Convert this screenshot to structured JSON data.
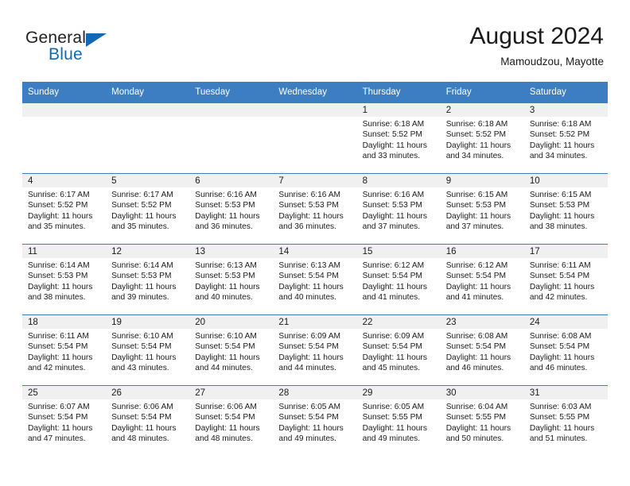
{
  "brand": {
    "name_top": "General",
    "name_bottom": "Blue",
    "triangle_color": "#1268b3"
  },
  "header": {
    "title": "August 2024",
    "subtitle": "Mamoudzou, Mayotte"
  },
  "theme": {
    "header_blue": "#3c7ec1",
    "daynum_band": "#f0f0f0",
    "text": "#1a1a1a"
  },
  "calendar": {
    "weekday_headers": [
      "Sunday",
      "Monday",
      "Tuesday",
      "Wednesday",
      "Thursday",
      "Friday",
      "Saturday"
    ],
    "labels": {
      "sunrise": "Sunrise:",
      "sunset": "Sunset:",
      "daylight": "Daylight:"
    },
    "weeks": [
      [
        {
          "day": "",
          "empty": true
        },
        {
          "day": "",
          "empty": true
        },
        {
          "day": "",
          "empty": true
        },
        {
          "day": "",
          "empty": true
        },
        {
          "day": "1",
          "sunrise": "Sunrise: 6:18 AM",
          "sunset": "Sunset: 5:52 PM",
          "daylight_1": "Daylight: 11 hours",
          "daylight_2": "and 33 minutes."
        },
        {
          "day": "2",
          "sunrise": "Sunrise: 6:18 AM",
          "sunset": "Sunset: 5:52 PM",
          "daylight_1": "Daylight: 11 hours",
          "daylight_2": "and 34 minutes."
        },
        {
          "day": "3",
          "sunrise": "Sunrise: 6:18 AM",
          "sunset": "Sunset: 5:52 PM",
          "daylight_1": "Daylight: 11 hours",
          "daylight_2": "and 34 minutes."
        }
      ],
      [
        {
          "day": "4",
          "sunrise": "Sunrise: 6:17 AM",
          "sunset": "Sunset: 5:52 PM",
          "daylight_1": "Daylight: 11 hours",
          "daylight_2": "and 35 minutes."
        },
        {
          "day": "5",
          "sunrise": "Sunrise: 6:17 AM",
          "sunset": "Sunset: 5:52 PM",
          "daylight_1": "Daylight: 11 hours",
          "daylight_2": "and 35 minutes."
        },
        {
          "day": "6",
          "sunrise": "Sunrise: 6:16 AM",
          "sunset": "Sunset: 5:53 PM",
          "daylight_1": "Daylight: 11 hours",
          "daylight_2": "and 36 minutes."
        },
        {
          "day": "7",
          "sunrise": "Sunrise: 6:16 AM",
          "sunset": "Sunset: 5:53 PM",
          "daylight_1": "Daylight: 11 hours",
          "daylight_2": "and 36 minutes."
        },
        {
          "day": "8",
          "sunrise": "Sunrise: 6:16 AM",
          "sunset": "Sunset: 5:53 PM",
          "daylight_1": "Daylight: 11 hours",
          "daylight_2": "and 37 minutes."
        },
        {
          "day": "9",
          "sunrise": "Sunrise: 6:15 AM",
          "sunset": "Sunset: 5:53 PM",
          "daylight_1": "Daylight: 11 hours",
          "daylight_2": "and 37 minutes."
        },
        {
          "day": "10",
          "sunrise": "Sunrise: 6:15 AM",
          "sunset": "Sunset: 5:53 PM",
          "daylight_1": "Daylight: 11 hours",
          "daylight_2": "and 38 minutes."
        }
      ],
      [
        {
          "day": "11",
          "sunrise": "Sunrise: 6:14 AM",
          "sunset": "Sunset: 5:53 PM",
          "daylight_1": "Daylight: 11 hours",
          "daylight_2": "and 38 minutes."
        },
        {
          "day": "12",
          "sunrise": "Sunrise: 6:14 AM",
          "sunset": "Sunset: 5:53 PM",
          "daylight_1": "Daylight: 11 hours",
          "daylight_2": "and 39 minutes."
        },
        {
          "day": "13",
          "sunrise": "Sunrise: 6:13 AM",
          "sunset": "Sunset: 5:53 PM",
          "daylight_1": "Daylight: 11 hours",
          "daylight_2": "and 40 minutes."
        },
        {
          "day": "14",
          "sunrise": "Sunrise: 6:13 AM",
          "sunset": "Sunset: 5:54 PM",
          "daylight_1": "Daylight: 11 hours",
          "daylight_2": "and 40 minutes."
        },
        {
          "day": "15",
          "sunrise": "Sunrise: 6:12 AM",
          "sunset": "Sunset: 5:54 PM",
          "daylight_1": "Daylight: 11 hours",
          "daylight_2": "and 41 minutes."
        },
        {
          "day": "16",
          "sunrise": "Sunrise: 6:12 AM",
          "sunset": "Sunset: 5:54 PM",
          "daylight_1": "Daylight: 11 hours",
          "daylight_2": "and 41 minutes."
        },
        {
          "day": "17",
          "sunrise": "Sunrise: 6:11 AM",
          "sunset": "Sunset: 5:54 PM",
          "daylight_1": "Daylight: 11 hours",
          "daylight_2": "and 42 minutes."
        }
      ],
      [
        {
          "day": "18",
          "sunrise": "Sunrise: 6:11 AM",
          "sunset": "Sunset: 5:54 PM",
          "daylight_1": "Daylight: 11 hours",
          "daylight_2": "and 42 minutes."
        },
        {
          "day": "19",
          "sunrise": "Sunrise: 6:10 AM",
          "sunset": "Sunset: 5:54 PM",
          "daylight_1": "Daylight: 11 hours",
          "daylight_2": "and 43 minutes."
        },
        {
          "day": "20",
          "sunrise": "Sunrise: 6:10 AM",
          "sunset": "Sunset: 5:54 PM",
          "daylight_1": "Daylight: 11 hours",
          "daylight_2": "and 44 minutes."
        },
        {
          "day": "21",
          "sunrise": "Sunrise: 6:09 AM",
          "sunset": "Sunset: 5:54 PM",
          "daylight_1": "Daylight: 11 hours",
          "daylight_2": "and 44 minutes."
        },
        {
          "day": "22",
          "sunrise": "Sunrise: 6:09 AM",
          "sunset": "Sunset: 5:54 PM",
          "daylight_1": "Daylight: 11 hours",
          "daylight_2": "and 45 minutes."
        },
        {
          "day": "23",
          "sunrise": "Sunrise: 6:08 AM",
          "sunset": "Sunset: 5:54 PM",
          "daylight_1": "Daylight: 11 hours",
          "daylight_2": "and 46 minutes."
        },
        {
          "day": "24",
          "sunrise": "Sunrise: 6:08 AM",
          "sunset": "Sunset: 5:54 PM",
          "daylight_1": "Daylight: 11 hours",
          "daylight_2": "and 46 minutes."
        }
      ],
      [
        {
          "day": "25",
          "sunrise": "Sunrise: 6:07 AM",
          "sunset": "Sunset: 5:54 PM",
          "daylight_1": "Daylight: 11 hours",
          "daylight_2": "and 47 minutes."
        },
        {
          "day": "26",
          "sunrise": "Sunrise: 6:06 AM",
          "sunset": "Sunset: 5:54 PM",
          "daylight_1": "Daylight: 11 hours",
          "daylight_2": "and 48 minutes."
        },
        {
          "day": "27",
          "sunrise": "Sunrise: 6:06 AM",
          "sunset": "Sunset: 5:54 PM",
          "daylight_1": "Daylight: 11 hours",
          "daylight_2": "and 48 minutes."
        },
        {
          "day": "28",
          "sunrise": "Sunrise: 6:05 AM",
          "sunset": "Sunset: 5:54 PM",
          "daylight_1": "Daylight: 11 hours",
          "daylight_2": "and 49 minutes."
        },
        {
          "day": "29",
          "sunrise": "Sunrise: 6:05 AM",
          "sunset": "Sunset: 5:55 PM",
          "daylight_1": "Daylight: 11 hours",
          "daylight_2": "and 49 minutes."
        },
        {
          "day": "30",
          "sunrise": "Sunrise: 6:04 AM",
          "sunset": "Sunset: 5:55 PM",
          "daylight_1": "Daylight: 11 hours",
          "daylight_2": "and 50 minutes."
        },
        {
          "day": "31",
          "sunrise": "Sunrise: 6:03 AM",
          "sunset": "Sunset: 5:55 PM",
          "daylight_1": "Daylight: 11 hours",
          "daylight_2": "and 51 minutes."
        }
      ]
    ]
  }
}
